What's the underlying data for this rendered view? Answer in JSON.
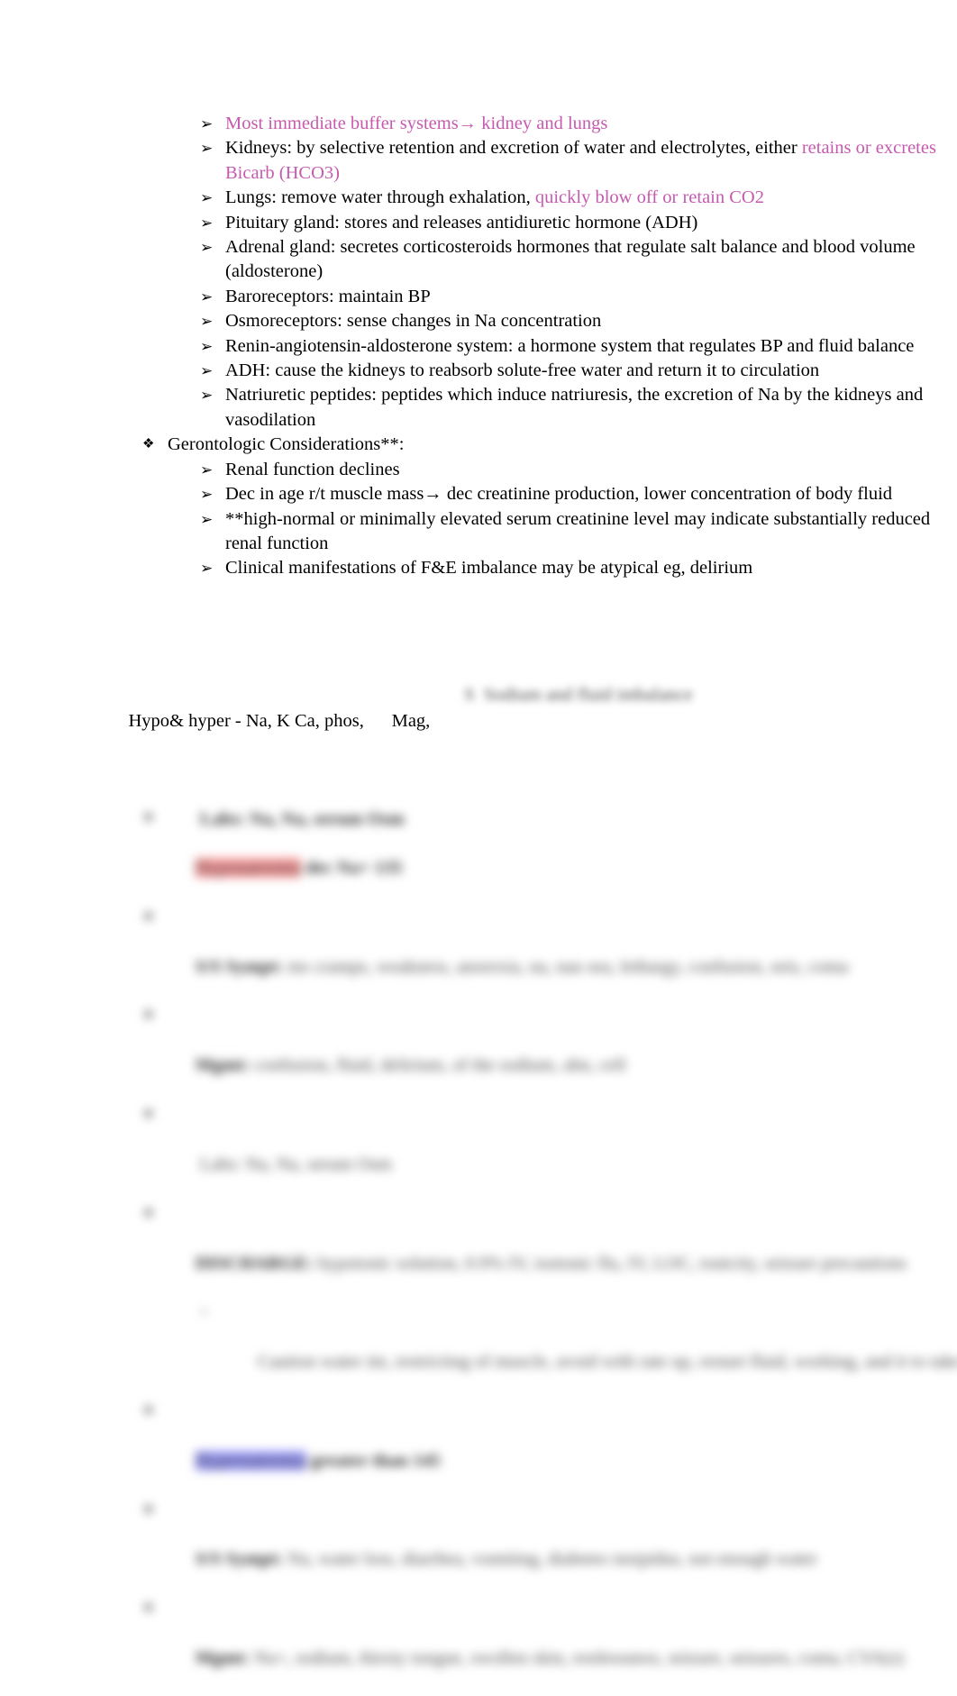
{
  "document": {
    "type": "study-notes",
    "colors": {
      "text": "#000000",
      "highlight_text_pink": "#c65aae",
      "highlight_red": "#fb9b9b",
      "highlight_blue": "#9b9bfb",
      "background": "#ffffff"
    },
    "bullets": {
      "arrow": "➢",
      "diamond": "❖"
    }
  },
  "section_mechanisms": {
    "items": [
      {
        "bullet": "➢",
        "level": 2,
        "segments": [
          {
            "text": "Most immediate buffer systems→ kidney and lungs",
            "color": "pink"
          }
        ]
      },
      {
        "bullet": "➢",
        "level": 2,
        "segments": [
          {
            "text": "Kidneys:",
            "color": "black"
          },
          {
            "text": "   by selective retention and excretion of water and electrolytes, either ",
            "color": "black"
          },
          {
            "text": "retains or excretes Bicarb (HCO3)",
            "color": "pink"
          }
        ]
      },
      {
        "bullet": "➢",
        "level": 2,
        "segments": [
          {
            "text": "Lungs:",
            "color": "black"
          },
          {
            "text": "   remove water through exhalation,      ",
            "color": "black"
          },
          {
            "text": "quickly blow off or retain CO2",
            "color": "pink"
          }
        ]
      },
      {
        "bullet": "➢",
        "level": 2,
        "segments": [
          {
            "text": "Pituitary gland:",
            "color": "black"
          },
          {
            "text": "     stores and releases antidiuretic hormone (ADH)",
            "color": "black"
          }
        ]
      },
      {
        "bullet": "➢",
        "level": 2,
        "segments": [
          {
            "text": "Adrenal gland:",
            "color": "black"
          },
          {
            "text": "     secretes corticosteroids hormones that regulate salt balance and blood volume (aldosterone)",
            "color": "black"
          }
        ]
      },
      {
        "bullet": "➢",
        "level": 2,
        "segments": [
          {
            "text": "Baroreceptors:",
            "color": "black"
          },
          {
            "text": "      maintain BP",
            "color": "black"
          }
        ]
      },
      {
        "bullet": "➢",
        "level": 2,
        "segments": [
          {
            "text": "Osmoreceptors:",
            "color": "black"
          },
          {
            "text": "      sense changes in Na concentration",
            "color": "black"
          }
        ]
      },
      {
        "bullet": "➢",
        "level": 2,
        "segments": [
          {
            "text": "Renin-angiotensin-aldosterone system:",
            "color": "black"
          },
          {
            "text": "          a hormone system that regulates BP and fluid balance",
            "color": "black"
          }
        ]
      },
      {
        "bullet": "➢",
        "level": 2,
        "segments": [
          {
            "text": "ADH:",
            "color": "black"
          },
          {
            "text": " cause the kidneys to reabsorb solute-free water and return it to circulation",
            "color": "black"
          }
        ]
      },
      {
        "bullet": "➢",
        "level": 2,
        "segments": [
          {
            "text": "Natriuretic peptides:",
            "color": "black"
          },
          {
            "text": "       peptides which induce natriuresis, the excretion of Na by the kidneys and vasodilation",
            "color": "black"
          }
        ]
      }
    ]
  },
  "section_gerontologic": {
    "heading": {
      "bullet": "❖",
      "text": "Gerontologic Considerations**:"
    },
    "items": [
      {
        "bullet": "➢",
        "text": "Renal function declines"
      },
      {
        "bullet": "➢",
        "text": "Dec in age r/t muscle mass→ dec creatinine production, lower concentration of body fluid"
      },
      {
        "bullet": "➢",
        "text": "**high-normal or minimally elevated serum creatinine level may indicate substantially reduced renal function"
      },
      {
        "bullet": "➢",
        "text": "Clinical manifestations of F&E imbalance may be atypical eg, delirium"
      }
    ]
  },
  "section_electrolytes": {
    "heading_visible": "Hypo& hyper - Na, K Ca, phos,      Mag,",
    "heading_blurred_tail": "  S  Sodium and fluid imbalance",
    "blurred_note": "Lower portion of the page is blurred and illegible",
    "blurred_lines": [
      {
        "indent": 2,
        "bullet": "❖",
        "highlight": "red",
        "highlight_text": "Hyponatremia",
        "rest": " dec Na+ 135"
      },
      {
        "indent": 2,
        "bullet": "❖",
        "bold": "S/S Sympt:",
        "rest": " ms cramps, weakness, anorexia, na, nau sea, lethargy, confusion, seiz, coma"
      },
      {
        "indent": 2,
        "bullet": "❖",
        "bold": "Mgmt:",
        "rest": " confusion, fluid, delirium, of the sodium, abn, cell"
      },
      {
        "indent": 2,
        "bullet": "❖",
        "rest": " Labs: Na, Na, serum Osm"
      },
      {
        "indent": 2,
        "bullet": "❖",
        "bold": "DISCHARGE:",
        "rest": " hypotonic solution, 0.9% IV, isotonic flu, IV, LOC, tonicity, seizure precautions"
      },
      {
        "indent": 3,
        "bullet": "○",
        "rest": " Caution water int, restricting of muscle, avoid with rate up, restart fluid, working, and it to take while, furosemide, diet to restrict pers, serum Na+, osm formulation succinct"
      },
      {
        "indent": 2,
        "bullet": "❖",
        "highlight": "blue",
        "highlight_text": "Hypernatremia",
        "rest": " greater than 145"
      },
      {
        "indent": 2,
        "bullet": "❖",
        "bold": "S/S Sympt:",
        "rest": " Na, water loss, diarrhea, vomiting, diabetes insipidus, not enough water"
      },
      {
        "indent": 2,
        "bullet": "❖",
        "bold": "Mgmt:",
        "rest": " Na+, sodium, thirsty tongue, swollen skin, restlessness, seizure, seizures, coma, CVA(s)"
      }
    ]
  }
}
